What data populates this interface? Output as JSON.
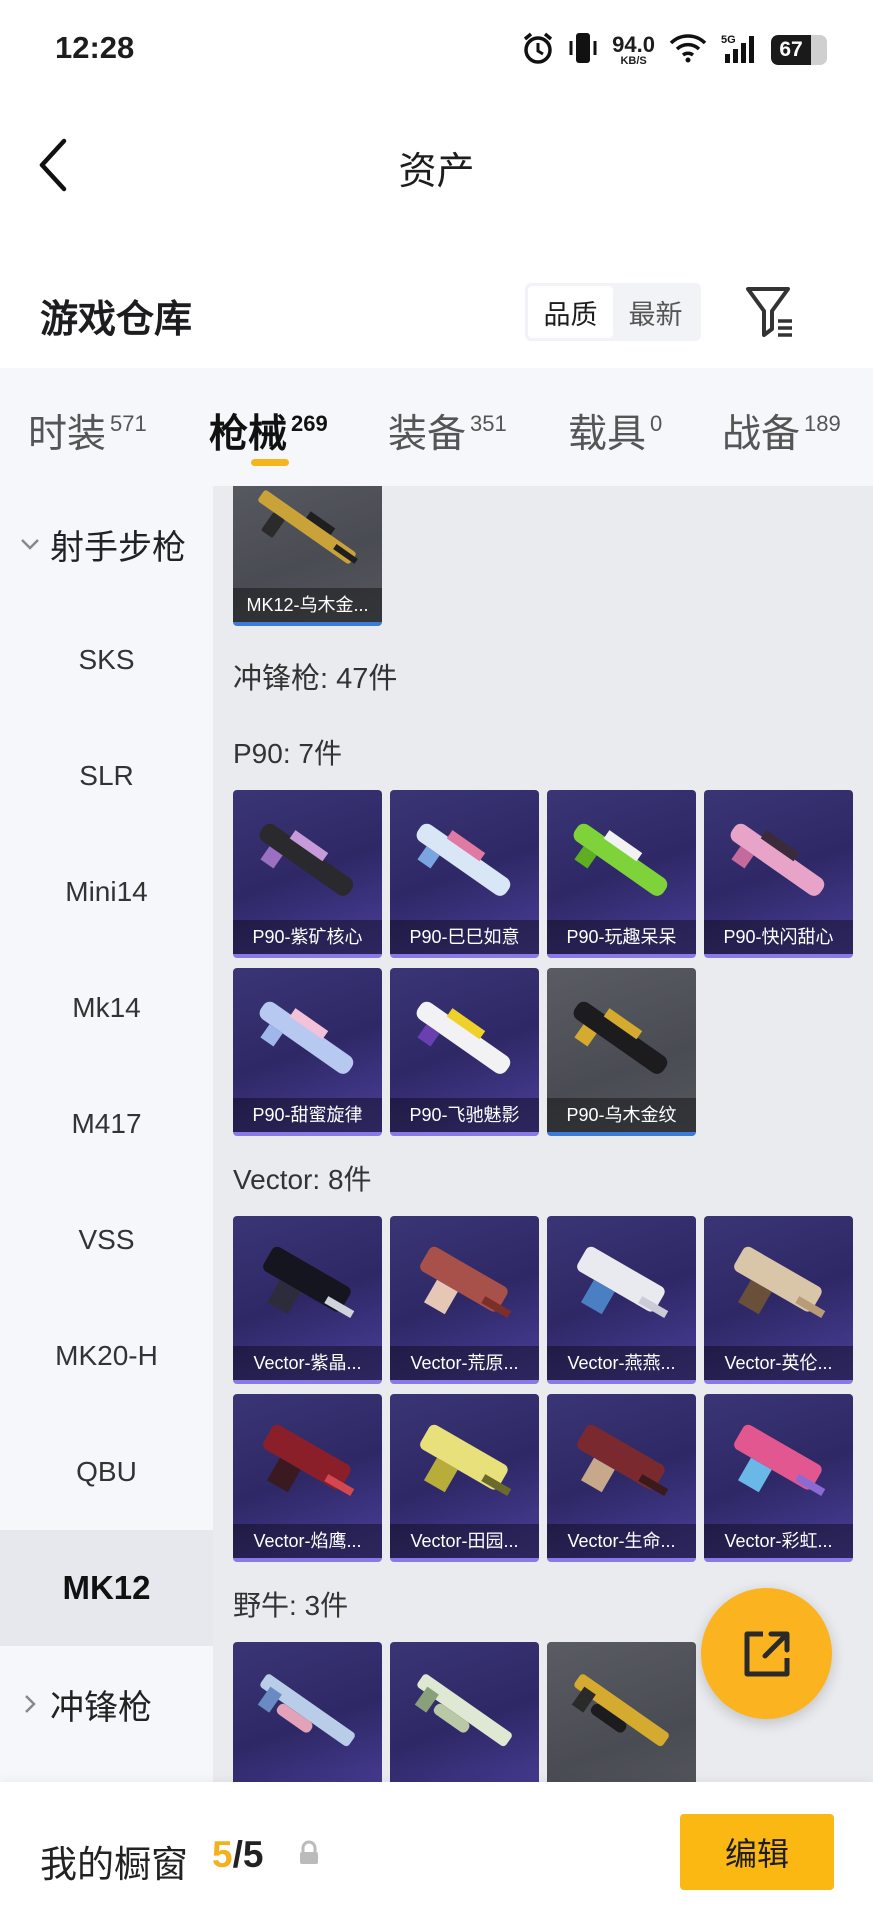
{
  "status_bar": {
    "time": "12:28",
    "net_speed": "94.0",
    "net_unit": "KB/S",
    "network": "5G",
    "battery": "67"
  },
  "header": {
    "title": "资产"
  },
  "warehouse": {
    "title": "游戏仓库",
    "sort_options": [
      "品质",
      "最新"
    ],
    "active_sort": "品质"
  },
  "tabs": [
    {
      "label": "时装",
      "count": "571"
    },
    {
      "label": "枪械",
      "count": "269"
    },
    {
      "label": "装备",
      "count": "351"
    },
    {
      "label": "载具",
      "count": "0"
    },
    {
      "label": "战备",
      "count": "189"
    }
  ],
  "active_tab": "枪械",
  "sidebar": {
    "group_open": "射手步枪",
    "items": [
      "SKS",
      "SLR",
      "Mini14",
      "Mk14",
      "M417",
      "VSS",
      "MK20-H",
      "QBU",
      "MK12"
    ],
    "active_item": "MK12",
    "group_next": "冲锋枪"
  },
  "content": {
    "top_card": "MK12-乌木金...",
    "category_title": "冲锋枪: 47件",
    "p90": {
      "title": "P90: 7件",
      "items": [
        "P90-紫矿核心",
        "P90-巳巳如意",
        "P90-玩趣呆呆",
        "P90-快闪甜心",
        "P90-甜蜜旋律",
        "P90-飞驰魅影",
        "P90-乌木金纹"
      ]
    },
    "vector": {
      "title": "Vector: 8件",
      "items": [
        "Vector-紫晶...",
        "Vector-荒原...",
        "Vector-燕燕...",
        "Vector-英伦...",
        "Vector-焰鹰...",
        "Vector-田园...",
        "Vector-生命...",
        "Vector-彩虹..."
      ]
    },
    "bison": {
      "title": "野牛: 3件"
    }
  },
  "bottom_bar": {
    "showcase_label": "我的橱窗",
    "showcase_current": "5",
    "showcase_total": "/5",
    "edit_label": "编辑"
  },
  "colors": {
    "accent": "#fbb812",
    "card_purple": "#2e2866",
    "card_gray": "#4a4c53"
  }
}
